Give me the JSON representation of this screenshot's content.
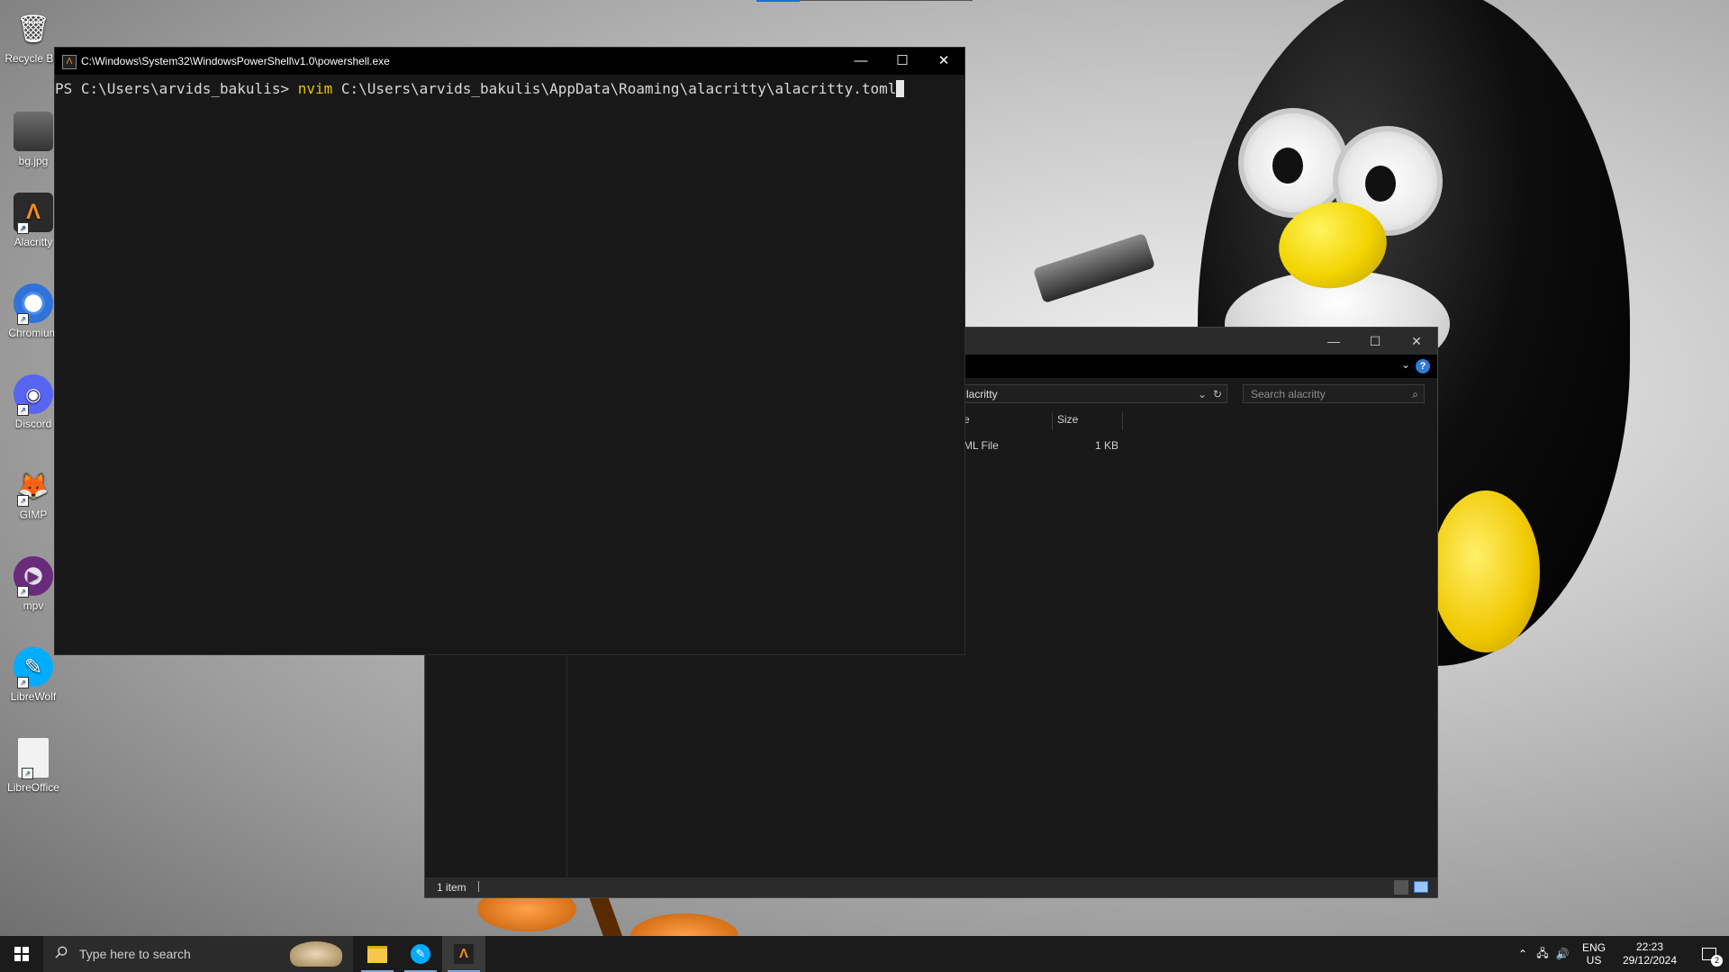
{
  "desktop": {
    "icons": [
      {
        "label": "Recycle Bin",
        "icon": "recycle-bin-icon"
      },
      {
        "label": "bg.jpg",
        "icon": "image-file-icon"
      },
      {
        "label": "Alacritty",
        "icon": "alacritty-icon"
      },
      {
        "label": "Chromium",
        "icon": "chromium-icon"
      },
      {
        "label": "Discord",
        "icon": "discord-icon"
      },
      {
        "label": "GIMP",
        "icon": "gimp-icon"
      },
      {
        "label": "mpv",
        "icon": "mpv-icon"
      },
      {
        "label": "LibreWolf",
        "icon": "librewolf-icon"
      },
      {
        "label": "LibreOffice",
        "icon": "libreoffice-icon"
      }
    ]
  },
  "powershell": {
    "title": "C:\\Windows\\System32\\WindowsPowerShell\\v1.0\\powershell.exe",
    "prompt": "PS C:\\Users\\arvids_bakulis> ",
    "command": "nvim",
    "argument": " C:\\Users\\arvids_bakulis\\AppData\\Roaming\\alacritty\\alacritty.toml",
    "controls": {
      "minimize": "—",
      "maximize": "☐",
      "close": "✕"
    }
  },
  "explorer": {
    "address": "lacritty",
    "search_placeholder": "Search alacritty",
    "columns": {
      "type": "e",
      "size": "Size"
    },
    "rows": [
      {
        "type": "ML File",
        "size": "1 KB"
      }
    ],
    "status": "1 item",
    "help": "?"
  },
  "taskbar": {
    "search_placeholder": "Type here to search",
    "language": "ENG",
    "region": "US",
    "time": "22:23",
    "date": "29/12/2024",
    "notifications": "2"
  },
  "colors": {
    "command_yellow": "#e3c200",
    "accent_blue": "#1f6fd0"
  }
}
